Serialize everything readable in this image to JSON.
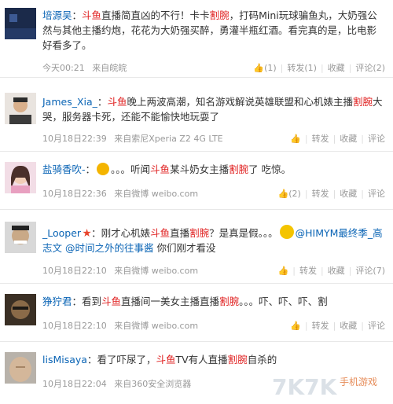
{
  "colors": {
    "link": "#0a64b5",
    "highlight": "#e02020",
    "meta": "#999999"
  },
  "action_labels": {
    "forward": "转发",
    "favorite": "收藏",
    "comment": "评论"
  },
  "posts": [
    {
      "user": "培源吴",
      "body_a": "：",
      "hl1": "斗鱼",
      "body_b": "直播简直凶的不行！卡卡",
      "hl2": "割腕",
      "body_c": "，打码Mini玩球骗鱼丸，大奶强公然与其他主播约炮，花花为大奶强买醉，勇灌半瓶红酒。看完真的是，比电影好看多了。",
      "time": "今天00:21",
      "source": "来自皖皖",
      "like": "(1)",
      "forward": "转发(1)",
      "favorite": "收藏",
      "comment": "评论(2)"
    },
    {
      "user": "James_Xia_",
      "body_a": "：",
      "hl1": "斗鱼",
      "body_b": "晚上两波高潮，知名游戏解说英雄联盟和心机婊主播",
      "hl2": "割腕",
      "body_c": "大哭，服务器卡死，还能不能愉快地玩耍了",
      "time": "10月18日22:39",
      "source": "来自索尼Xperia Z2 4G LTE",
      "like": "",
      "forward": "转发",
      "favorite": "收藏",
      "comment": "评论"
    },
    {
      "user": "盐骑香吹-",
      "body_a": "：",
      "body_dots": "。。。听闻",
      "hl1": "斗鱼",
      "body_b": "某斗奶女主播",
      "hl2": "割腕",
      "body_c": "了 吃惊。",
      "time": "10月18日22:36",
      "source": "来自微博 weibo.com",
      "like": "(2)",
      "forward": "转发",
      "favorite": "收藏",
      "comment": "评论"
    },
    {
      "user": "_Looper",
      "body_a": "：刚才心机婊",
      "hl1": "斗鱼",
      "body_b": "直播",
      "hl2": "割腕",
      "body_c": "？是真是假。。。",
      "at1": "@HIMYM最终季_高志文",
      "at2": "@时间之外的往事酱",
      "body_d": " 你们刚才看没",
      "time": "10月18日22:10",
      "source": "来自微博 weibo.com",
      "like": "",
      "forward": "转发",
      "favorite": "收藏",
      "comment": "评论(7)"
    },
    {
      "user": "狰狞君",
      "body_a": "：看到",
      "hl1": "斗鱼",
      "body_b": "直播间一美女主播直播",
      "hl2": "割腕",
      "body_c": "。。。吓、吓、吓、割",
      "time": "10月18日22:10",
      "source": "来自微博 weibo.com",
      "like": "",
      "forward": "转发",
      "favorite": "收藏",
      "comment": "评论"
    },
    {
      "user": "lisMisaya",
      "body_a": "：看了吓尿了，",
      "hl1": "斗鱼",
      "body_b": "TV有人直播",
      "hl2": "割腕",
      "body_c": "自杀的",
      "time": "10月18日22:04",
      "source": "来自360安全浏览器",
      "like": "",
      "forward": "",
      "favorite": "",
      "comment": ""
    }
  ],
  "watermark": {
    "brand": "7K7K",
    "tag": "手机游戏"
  }
}
